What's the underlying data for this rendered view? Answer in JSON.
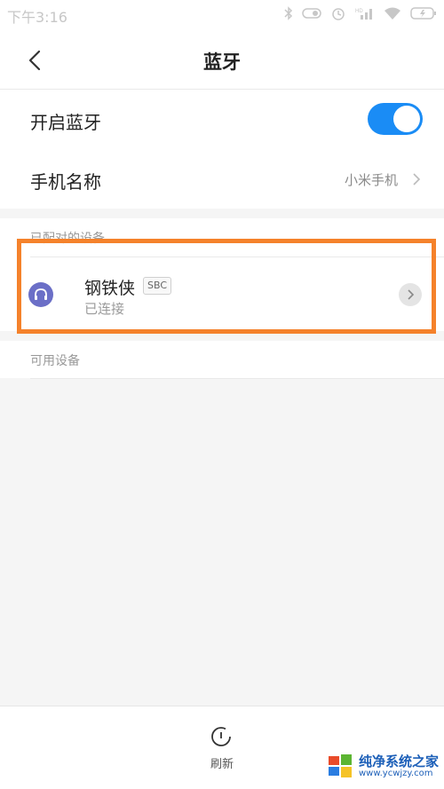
{
  "status_bar": {
    "time": "下午3:16",
    "icons": [
      "bluetooth-icon",
      "vibrate-icon",
      "alarm-icon",
      "signal-icon",
      "wifi-icon",
      "battery-icon"
    ]
  },
  "header": {
    "title": "蓝牙",
    "back_icon": "chevron-left-icon"
  },
  "settings": {
    "bluetooth_label": "开启蓝牙",
    "bluetooth_on": true,
    "phone_name_label": "手机名称",
    "phone_name_value": "小米手机"
  },
  "paired": {
    "header": "已配对的设备",
    "device": {
      "name": "钢铁侠",
      "codec": "SBC",
      "status": "已连接",
      "icon": "headset-icon"
    }
  },
  "available": {
    "header": "可用设备"
  },
  "bottom": {
    "refresh_label": "刷新"
  },
  "watermark": {
    "text": "纯净系统之家",
    "sub": "www.ycwjzy.com"
  },
  "colors": {
    "accent": "#1a8cf5",
    "highlight": "#f5822b",
    "device_icon_bg": "#6b6fc7"
  }
}
